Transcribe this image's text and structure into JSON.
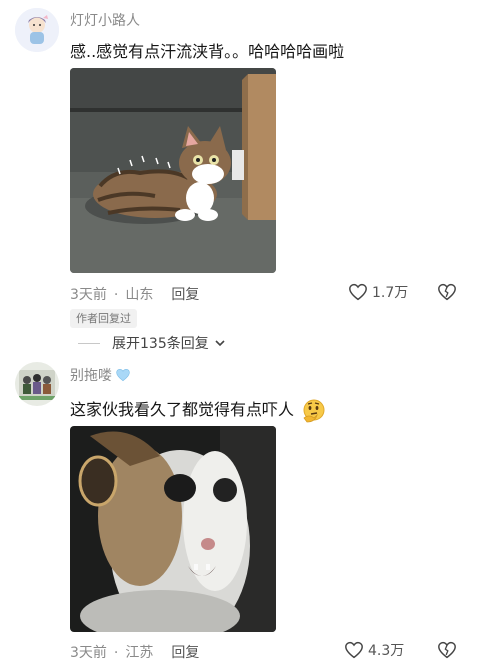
{
  "comments": [
    {
      "username": "灯灯小路人",
      "text": "感..感觉有点汗流浃背。。哈哈哈哈画啦",
      "time": "3天前",
      "location": "山东",
      "reply_label": "回复",
      "likes": "1.7万",
      "author_tag": "作者回复过",
      "expand_label": "展开135条回复",
      "avatar_icon": "girl-cartoon-avatar",
      "image_subject": "cartoon-tabby-cat-sweating"
    },
    {
      "username": "别拖喽",
      "username_badge_icon": "light-blue-heart-icon",
      "text": "这家伙我看久了都觉得有点吓人",
      "text_emoji_icon": "thinking-face-emoji",
      "time": "3天前",
      "location": "江苏",
      "reply_label": "回复",
      "likes": "4.3万",
      "avatar_icon": "group-photo-avatar",
      "image_subject": "blurry-shocked-cat-photo"
    }
  ],
  "colors": {
    "meta_gray": "#8a8a8a",
    "text_dark": "#161616",
    "heart_badge": "#9fd3f5"
  }
}
